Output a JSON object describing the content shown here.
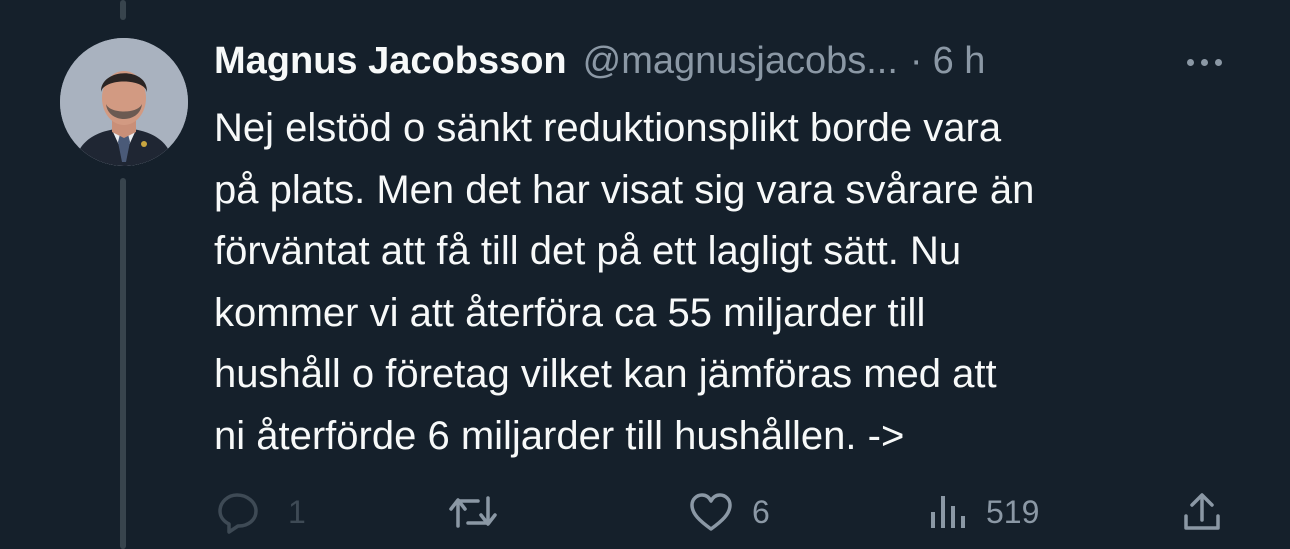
{
  "tweet": {
    "author": {
      "display_name": "Magnus Jacobsson",
      "handle": "@magnusjacobs...",
      "avatar_icon": "profile-photo"
    },
    "separator": "·",
    "time_ago": "6 h",
    "text_lines": [
      "Nej elstöd o sänkt reduktionsplikt borde vara",
      "på plats. Men det har visat sig vara svårare än",
      "förväntat att få till det på ett lagligt sätt. Nu",
      "kommer vi att återföra ca 55 miljarder till",
      "hushåll o företag vilket kan jämföras med att",
      "ni återförde 6 miljarder till hushållen. ->"
    ],
    "stats": {
      "replies": "1",
      "retweets": "",
      "likes": "6",
      "views": "519"
    }
  },
  "colors": {
    "background": "#15202b",
    "text_primary": "#f7f9f9",
    "text_secondary": "#8b98a5",
    "thread_line": "#38444d",
    "reply_muted": "#3e4a55"
  },
  "icons": {
    "more": "more-dots-icon",
    "reply": "reply-bubble-icon",
    "retweet": "retweet-icon",
    "like": "heart-icon",
    "views": "views-bars-icon",
    "share": "share-upload-icon"
  }
}
